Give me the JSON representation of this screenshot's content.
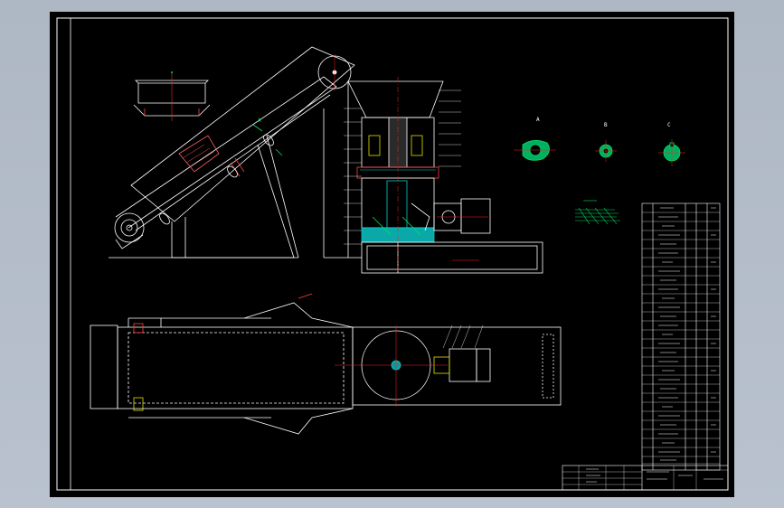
{
  "colors": {
    "background": "#b3bcc9",
    "sheet": "#000000",
    "line": "#ffffff",
    "accent_red": "#ff2020",
    "accent_green": "#00e060",
    "accent_cyan": "#00d0d0",
    "accent_yellow": "#e0e000",
    "accent_magenta": "#ff40ff"
  },
  "views": {
    "section_a": {
      "label": "A"
    },
    "section_b": {
      "label": "B"
    },
    "section_c": {
      "label": "C"
    }
  },
  "icons": {
    "title_block": "table-grid-icon",
    "parts_list": "list-icon"
  }
}
